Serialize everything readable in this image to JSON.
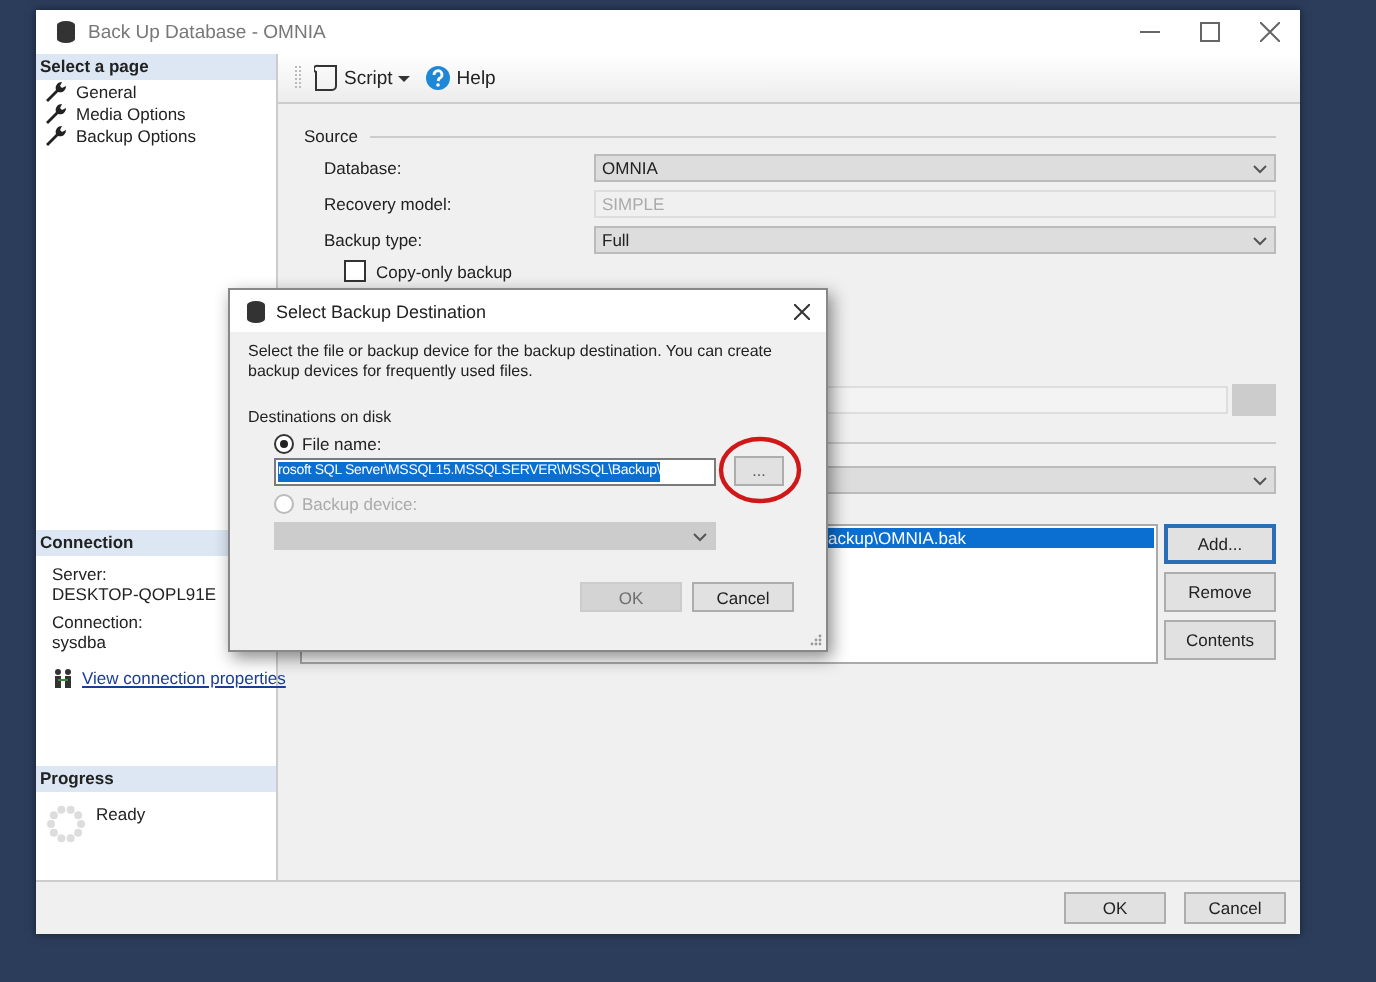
{
  "window": {
    "title": "Back Up Database - OMNIA"
  },
  "sidebar": {
    "header": "Select a page",
    "items": [
      {
        "label": "General"
      },
      {
        "label": "Media Options"
      },
      {
        "label": "Backup Options"
      }
    ]
  },
  "connection": {
    "header": "Connection",
    "server_label": "Server:",
    "server": "DESKTOP-QOPL91E",
    "connection_label": "Connection:",
    "connection": "sysdba",
    "link": "View connection properties"
  },
  "progress": {
    "header": "Progress",
    "status": "Ready"
  },
  "toolbar": {
    "items": [
      {
        "label": "Script",
        "kind": "dropdown"
      },
      {
        "label": "Help",
        "kind": "help"
      }
    ]
  },
  "source": {
    "title": "Source",
    "fields": [
      {
        "label": "Database:",
        "value": "OMNIA",
        "kind": "combo"
      },
      {
        "label": "Recovery model:",
        "value": "SIMPLE",
        "kind": "readonly"
      },
      {
        "label": "Backup type:",
        "value": "Full",
        "kind": "combo"
      }
    ],
    "copy_only": {
      "label": "Copy-only backup",
      "checked": false
    }
  },
  "destination": {
    "files": [
      {
        "path": "ackup\\OMNIA.bak",
        "selected": true
      }
    ],
    "buttons": [
      {
        "label": "Add...",
        "focused": true
      },
      {
        "label": "Remove",
        "focused": false
      },
      {
        "label": "Contents",
        "focused": false
      }
    ]
  },
  "footer": {
    "buttons": [
      "OK",
      "Cancel"
    ]
  },
  "dialog": {
    "title": "Select Backup Destination",
    "description": "Select the file or backup device for the backup destination. You can create backup devices for frequently used files.",
    "group_label": "Destinations on disk",
    "options": [
      {
        "label": "File name:",
        "selected": true,
        "disabled": false
      },
      {
        "label": "Backup device:",
        "selected": false,
        "disabled": true
      }
    ],
    "file_name": "rosoft SQL Server\\MSSQL15.MSSQLSERVER\\MSSQL\\Backup\\",
    "browse": "...",
    "buttons": [
      {
        "label": "OK",
        "disabled": true
      },
      {
        "label": "Cancel",
        "disabled": false
      }
    ]
  }
}
